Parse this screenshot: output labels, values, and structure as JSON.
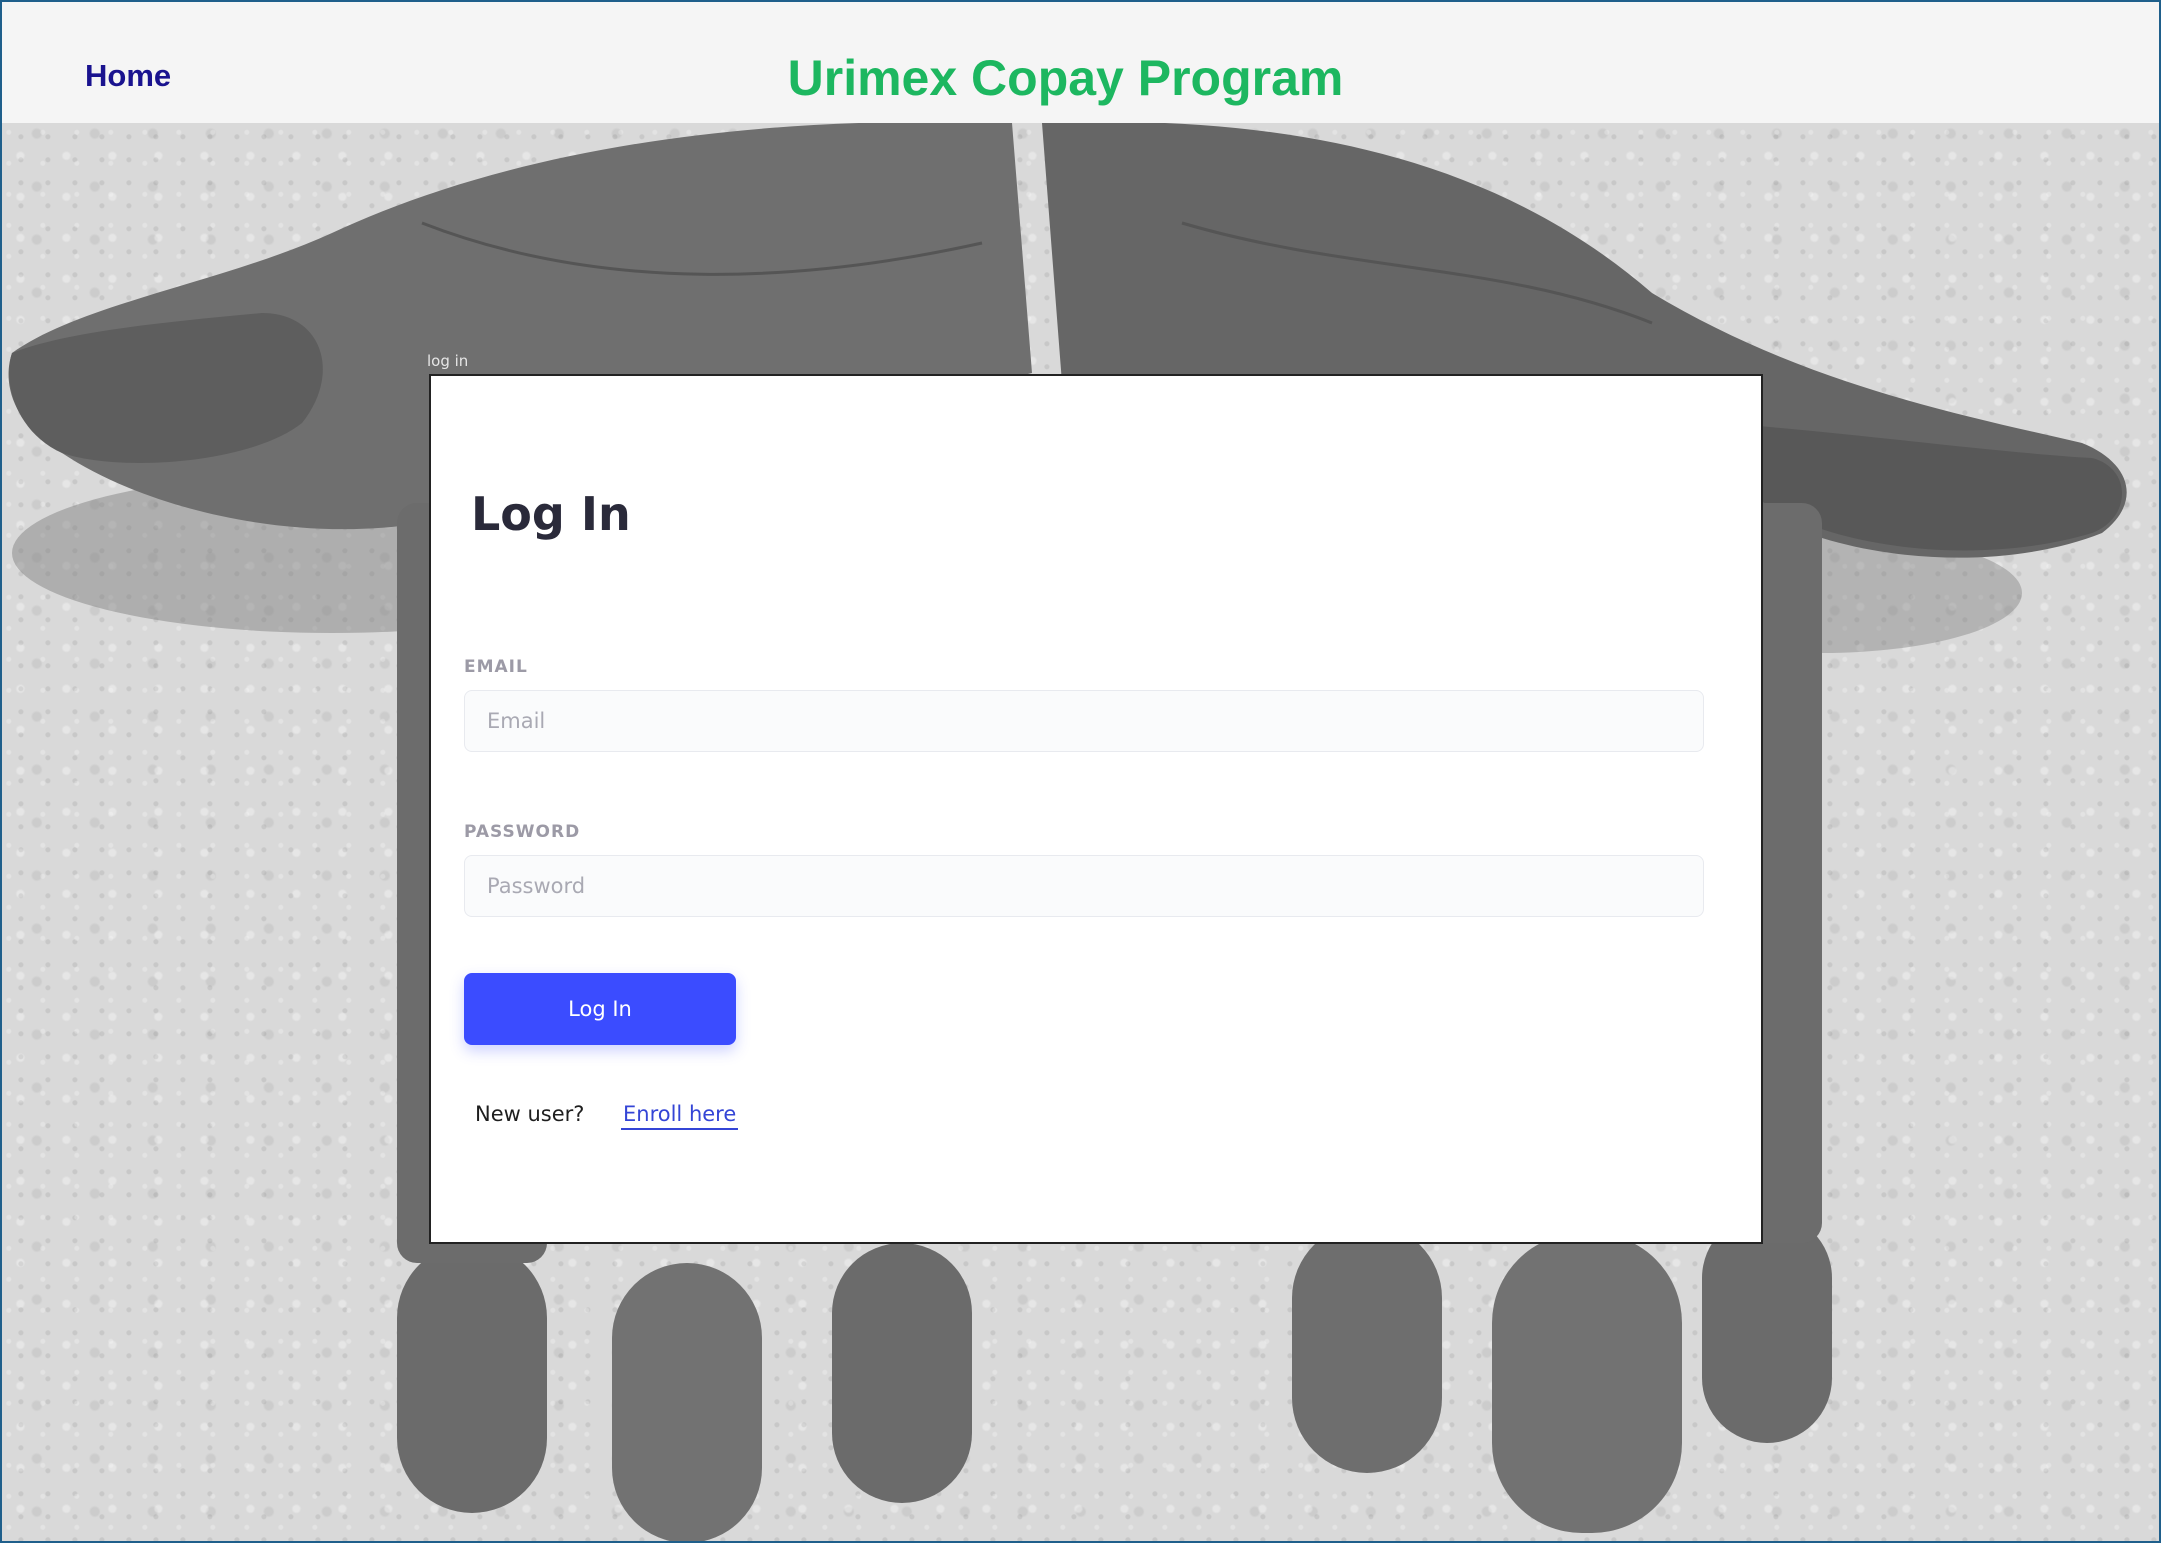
{
  "header": {
    "home_label": "Home",
    "site_title": "Urimex Copay Program"
  },
  "card": {
    "caption": "log in",
    "title": "Log In",
    "email_label": "EMAIL",
    "email_placeholder": "Email",
    "email_value": "",
    "password_label": "PASSWORD",
    "password_placeholder": "Password",
    "password_value": "",
    "login_button": "Log In",
    "new_user_text": "New user?",
    "enroll_link": "Enroll here"
  },
  "colors": {
    "title_green": "#1db760",
    "home_navy": "#1a138f",
    "button_blue": "#3b4cff",
    "link_blue": "#3445d6"
  }
}
